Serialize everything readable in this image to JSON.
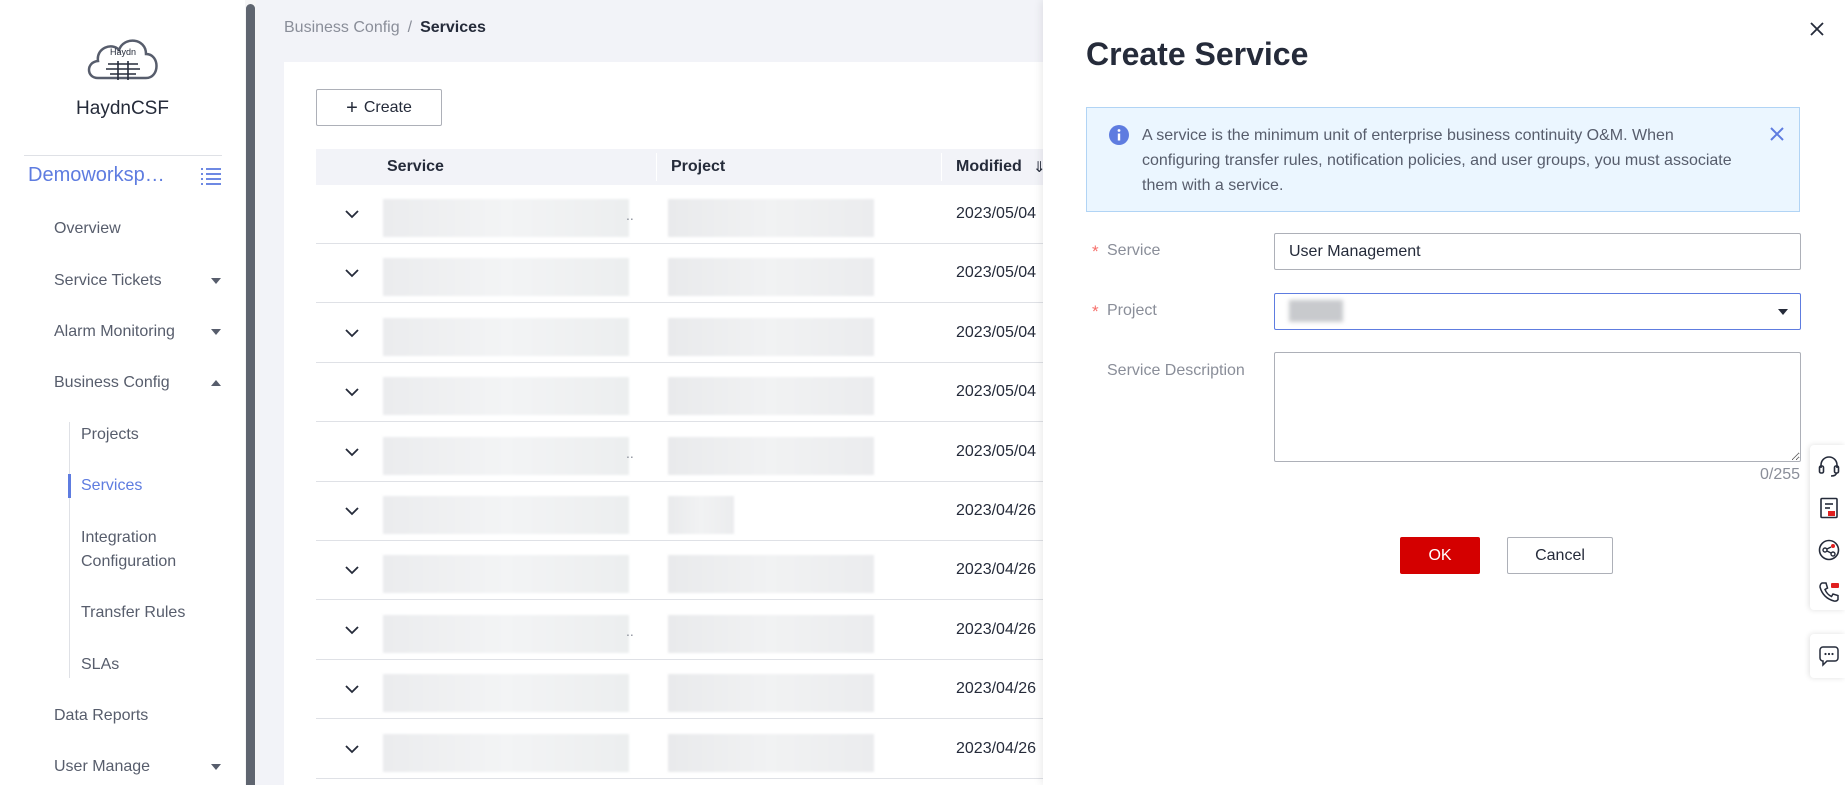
{
  "sidebar": {
    "brand": "HaydnCSF",
    "logo_text": "Haydn",
    "workspace": "Demoworksp…",
    "nav": {
      "overview": "Overview",
      "service_tickets": "Service Tickets",
      "alarm_monitoring": "Alarm Monitoring",
      "business_config": "Business Config",
      "projects": "Projects",
      "services": "Services",
      "integration_configuration": "Integration Configuration",
      "transfer_rules": "Transfer Rules",
      "slas": "SLAs",
      "data_reports": "Data Reports",
      "user_manage": "User Manage"
    }
  },
  "breadcrumb": {
    "parent": "Business Config",
    "separator": "/",
    "current": "Services"
  },
  "toolbar": {
    "create_label": "Create",
    "create_icon": "plus-icon"
  },
  "table": {
    "columns": {
      "service": "Service",
      "project": "Project",
      "modified": "Modified"
    },
    "rows": [
      {
        "modified": "2023/05/04"
      },
      {
        "modified": "2023/05/04"
      },
      {
        "modified": "2023/05/04"
      },
      {
        "modified": "2023/05/04"
      },
      {
        "modified": "2023/05/04"
      },
      {
        "modified": "2023/04/26"
      },
      {
        "modified": "2023/04/26"
      },
      {
        "modified": "2023/04/26"
      },
      {
        "modified": "2023/04/26"
      },
      {
        "modified": "2023/04/26"
      }
    ]
  },
  "drawer": {
    "title": "Create Service",
    "info": "A service is the minimum unit of enterprise business continuity O&M. When configuring transfer rules, notification policies, and user groups, you must associate them with a service.",
    "form": {
      "service_label": "Service",
      "service_value": "User Management",
      "project_label": "Project",
      "description_label": "Service Description",
      "counter": "0/255",
      "required_mark": "*"
    },
    "ok_label": "OK",
    "cancel_label": "Cancel"
  },
  "colors": {
    "accent": "#5e7ce0",
    "primary_button": "#d40000",
    "info_background": "#ebf6ff",
    "required": "#f66f6a"
  },
  "floating_tools": [
    "headset-icon",
    "manual-icon",
    "share-icon",
    "phone-icon",
    "chat-icon"
  ]
}
